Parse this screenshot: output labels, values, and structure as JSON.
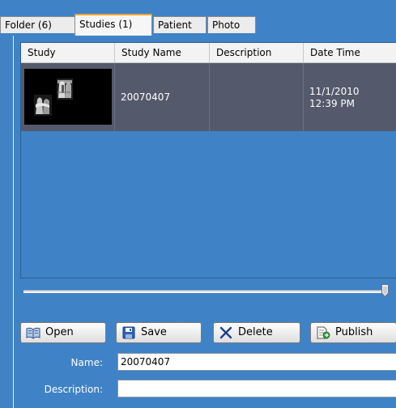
{
  "tabs": [
    {
      "label": "Folder (6)",
      "active": false
    },
    {
      "label": "Studies (1)",
      "active": true
    },
    {
      "label": "Patient",
      "active": false
    },
    {
      "label": "Photo",
      "active": false
    }
  ],
  "list": {
    "columns": [
      "Study",
      "Study Name",
      "Description",
      "Date Time"
    ],
    "rows": [
      {
        "thumbnail": "dental-xray-thumbnail",
        "study_name": "20070407",
        "description": "",
        "date_time": "11/1/2010 12:39 PM"
      }
    ]
  },
  "slider": {
    "value_percent": 100
  },
  "buttons": {
    "open": "Open",
    "save": "Save",
    "delete": "Delete",
    "publish": "Publish"
  },
  "form": {
    "name_label": "Name:",
    "name_value": "20070407",
    "description_label": "Description:",
    "description_value": ""
  },
  "icons": {
    "open": "open-book-icon",
    "save": "floppy-disk-icon",
    "delete": "x-icon",
    "publish": "publish-document-icon"
  },
  "colors": {
    "panel_background": "#3f82c6",
    "selected_row": "#545a6b",
    "active_tab_accent": "#f0a030"
  }
}
